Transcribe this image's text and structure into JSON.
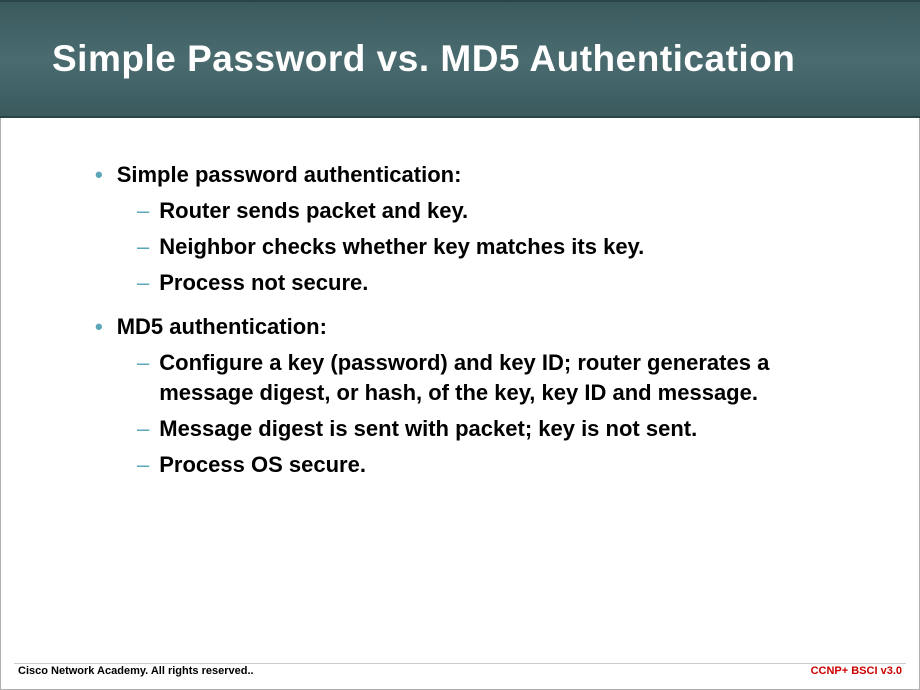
{
  "title": "Simple Password vs. MD5 Authentication",
  "sections": [
    {
      "heading": "Simple password authentication:",
      "items": [
        "Router sends packet and key.",
        "Neighbor checks whether key matches its key.",
        "Process not secure."
      ]
    },
    {
      "heading": "MD5 authentication:",
      "items": [
        "Configure a key (password) and key ID; router generates a message digest, or hash, of the key, key ID and message.",
        "Message digest is sent with packet; key is not sent.",
        "Process OS secure."
      ]
    }
  ],
  "footer": {
    "left": "Cisco Network Academy. All rights reserved..",
    "right": "CCNP+ BSCI v3.0"
  }
}
